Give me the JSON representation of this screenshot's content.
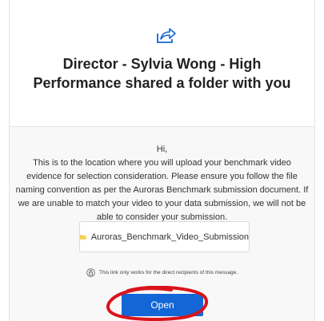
{
  "email": {
    "header": {
      "icon": "share-icon",
      "title": "Director - Sylvia Wong - High Performance shared a folder with you"
    },
    "message": {
      "greeting": "Hi,",
      "body": "This is to the location where you will upload your benchmark video evidence for selection consideration.  Please ensure you follow the file naming convention as per the Auroras Benchmark submission document.  If we are unable to match your video to your data submission, we will not be able to consider your submission."
    },
    "folder": {
      "icon": "folder-icon",
      "name": "Auroras_Benchmark_Video_Submission"
    },
    "notice": {
      "icon": "lock-icon",
      "text": "This link only works for the direct recipients of this message."
    },
    "open_button": {
      "label": "Open"
    }
  },
  "colors": {
    "accent": "#1366d6",
    "annotation": "#d9141b",
    "folder": "#f7c342"
  }
}
